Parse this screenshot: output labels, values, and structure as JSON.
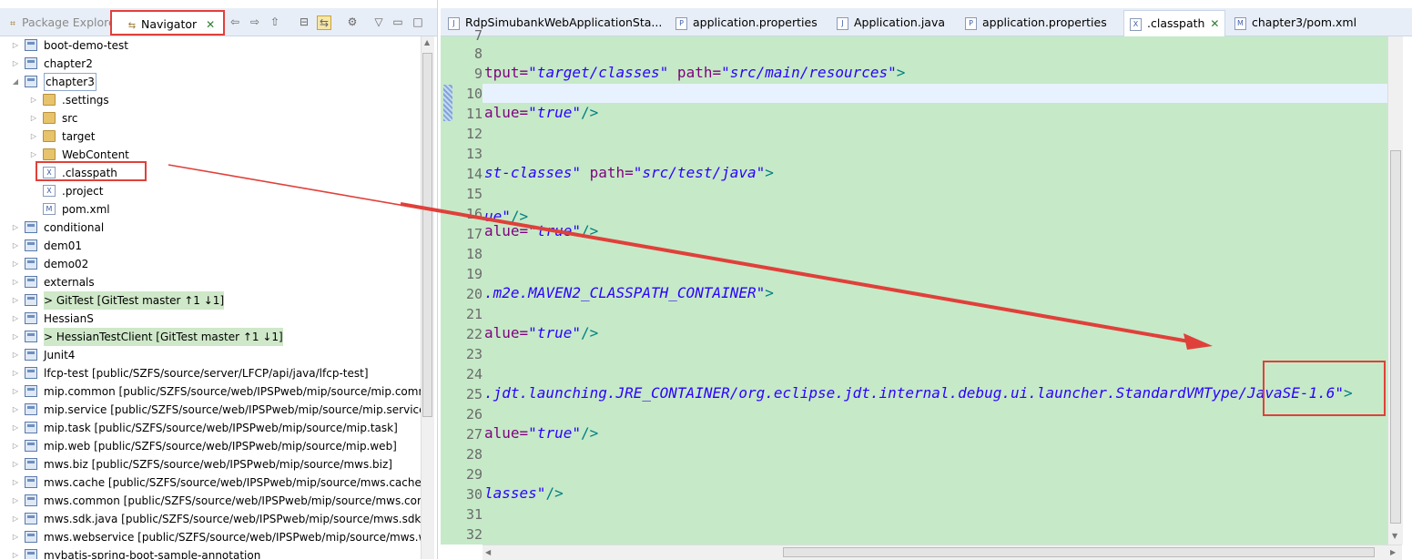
{
  "left_panel": {
    "tabs": [
      {
        "label": "Package Explorer",
        "active": false
      },
      {
        "label": "Navigator",
        "active": true
      }
    ],
    "toolbar_icons": [
      "back-icon",
      "forward-icon",
      "up-icon",
      "collapse-all-icon",
      "link-with-editor-icon",
      "filters-icon",
      "view-menu-icon",
      "minimize-icon",
      "maximize-icon"
    ],
    "tree": [
      {
        "label": "boot-demo-test",
        "level": 0,
        "icon": "project",
        "expanded": false
      },
      {
        "label": "chapter2",
        "level": 0,
        "icon": "project",
        "expanded": false
      },
      {
        "label": "chapter3",
        "level": 0,
        "icon": "project",
        "expanded": true,
        "selected": true
      },
      {
        "label": ".settings",
        "level": 1,
        "icon": "folder",
        "expanded": false
      },
      {
        "label": "src",
        "level": 1,
        "icon": "folder",
        "expanded": false
      },
      {
        "label": "target",
        "level": 1,
        "icon": "folder",
        "expanded": false
      },
      {
        "label": "WebContent",
        "level": 1,
        "icon": "folder",
        "expanded": false
      },
      {
        "label": ".classpath",
        "level": 1,
        "icon": "xml-file",
        "leaf": true,
        "highlighted": true
      },
      {
        "label": ".project",
        "level": 1,
        "icon": "xml-file",
        "leaf": true
      },
      {
        "label": "pom.xml",
        "level": 1,
        "icon": "maven-file",
        "leaf": true
      },
      {
        "label": "conditional",
        "level": 0,
        "icon": "project",
        "expanded": false
      },
      {
        "label": "dem01",
        "level": 0,
        "icon": "project",
        "expanded": false
      },
      {
        "label": "demo02",
        "level": 0,
        "icon": "project",
        "expanded": false
      },
      {
        "label": "externals",
        "level": 0,
        "icon": "project",
        "expanded": false
      },
      {
        "label": "> GitTest  [GitTest master ↑1 ↓1]",
        "level": 0,
        "icon": "project",
        "expanded": false,
        "git": true
      },
      {
        "label": "HessianS",
        "level": 0,
        "icon": "project",
        "expanded": false
      },
      {
        "label": "> HessianTestClient  [GitTest master ↑1 ↓1]",
        "level": 0,
        "icon": "project",
        "expanded": false,
        "git": true
      },
      {
        "label": "Junit4",
        "level": 0,
        "icon": "project",
        "expanded": false
      },
      {
        "label": "lfcp-test [public/SZFS/source/server/LFCP/api/java/lfcp-test]",
        "level": 0,
        "icon": "project",
        "expanded": false
      },
      {
        "label": "mip.common [public/SZFS/source/web/IPSPweb/mip/source/mip.common]",
        "level": 0,
        "icon": "project",
        "expanded": false
      },
      {
        "label": "mip.service [public/SZFS/source/web/IPSPweb/mip/source/mip.service]",
        "level": 0,
        "icon": "project",
        "expanded": false
      },
      {
        "label": "mip.task [public/SZFS/source/web/IPSPweb/mip/source/mip.task]",
        "level": 0,
        "icon": "project",
        "expanded": false
      },
      {
        "label": "mip.web [public/SZFS/source/web/IPSPweb/mip/source/mip.web]",
        "level": 0,
        "icon": "project",
        "expanded": false
      },
      {
        "label": "mws.biz [public/SZFS/source/web/IPSPweb/mip/source/mws.biz]",
        "level": 0,
        "icon": "project",
        "expanded": false
      },
      {
        "label": "mws.cache [public/SZFS/source/web/IPSPweb/mip/source/mws.cache]",
        "level": 0,
        "icon": "project",
        "expanded": false
      },
      {
        "label": "mws.common [public/SZFS/source/web/IPSPweb/mip/source/mws.common]",
        "level": 0,
        "icon": "project",
        "expanded": false
      },
      {
        "label": "mws.sdk.java [public/SZFS/source/web/IPSPweb/mip/source/mws.sdk.java]",
        "level": 0,
        "icon": "project",
        "expanded": false
      },
      {
        "label": "mws.webservice [public/SZFS/source/web/IPSPweb/mip/source/mws.webservice]",
        "level": 0,
        "icon": "project",
        "expanded": false
      },
      {
        "label": "mybatis-spring-boot-sample-annotation",
        "level": 0,
        "icon": "project",
        "expanded": false
      }
    ]
  },
  "editor": {
    "tabs": [
      {
        "label": "RdpSimubankWebApplicationSta...",
        "icon": "J",
        "active": false
      },
      {
        "label": "application.properties",
        "icon": "P",
        "active": false
      },
      {
        "label": "Application.java",
        "icon": "J",
        "active": false
      },
      {
        "label": "application.properties",
        "icon": "P",
        "active": false
      },
      {
        "label": ".classpath",
        "icon": "X",
        "active": true
      },
      {
        "label": "chapter3/pom.xml",
        "icon": "M",
        "active": false
      }
    ],
    "lines": [
      {
        "n": "7",
        "segments": []
      },
      {
        "n": "8",
        "segments": []
      },
      {
        "n": "9",
        "segments": [
          {
            "t": "tput=",
            "c": "a"
          },
          {
            "t": "\"target/classes\"",
            "c": "v"
          },
          {
            "t": " path=",
            "c": "a"
          },
          {
            "t": "\"src/main/resources\"",
            "c": "v"
          },
          {
            "t": ">",
            "c": "t"
          }
        ]
      },
      {
        "n": "10",
        "segments": []
      },
      {
        "n": "11",
        "segments": [
          {
            "t": "alue=",
            "c": "a"
          },
          {
            "t": "\"true\"",
            "c": "v"
          },
          {
            "t": "/>",
            "c": "t"
          }
        ]
      },
      {
        "n": "12",
        "segments": []
      },
      {
        "n": "13",
        "segments": []
      },
      {
        "n": "14",
        "segments": [
          {
            "t": "st-classes\"",
            "c": "v"
          },
          {
            "t": " path=",
            "c": "a"
          },
          {
            "t": "\"src/test/java\"",
            "c": "v"
          },
          {
            "t": ">",
            "c": "t"
          }
        ]
      },
      {
        "n": "15",
        "segments": []
      },
      {
        "n": "16",
        "segments": [
          {
            "t": "ue\"",
            "c": "v"
          },
          {
            "t": "/>",
            "c": "t"
          }
        ]
      },
      {
        "n": "17",
        "segments": [
          {
            "t": "alue=",
            "c": "a"
          },
          {
            "t": "\"true\"",
            "c": "v"
          },
          {
            "t": "/>",
            "c": "t"
          }
        ]
      },
      {
        "n": "18",
        "segments": []
      },
      {
        "n": "19",
        "segments": []
      },
      {
        "n": "20",
        "segments": [
          {
            "t": ".m2e.MAVEN2_CLASSPATH_CONTAINER\"",
            "c": "v"
          },
          {
            "t": ">",
            "c": "t"
          }
        ]
      },
      {
        "n": "21",
        "segments": []
      },
      {
        "n": "22",
        "segments": [
          {
            "t": "alue=",
            "c": "a"
          },
          {
            "t": "\"true\"",
            "c": "v"
          },
          {
            "t": "/>",
            "c": "t"
          }
        ]
      },
      {
        "n": "23",
        "segments": []
      },
      {
        "n": "24",
        "segments": []
      },
      {
        "n": "25",
        "segments": [
          {
            "t": ".jdt.launching.JRE_CONTAINER/org.eclipse.jdt.internal.debug.ui.launcher.StandardVMType/JavaSE-1.6\"",
            "c": "v"
          },
          {
            "t": ">",
            "c": "t"
          }
        ]
      },
      {
        "n": "26",
        "segments": []
      },
      {
        "n": "27",
        "segments": [
          {
            "t": "alue=",
            "c": "a"
          },
          {
            "t": "\"true\"",
            "c": "v"
          },
          {
            "t": "/>",
            "c": "t"
          }
        ]
      },
      {
        "n": "28",
        "segments": []
      },
      {
        "n": "29",
        "segments": []
      },
      {
        "n": "30",
        "segments": [
          {
            "t": "lasses\"",
            "c": "v"
          },
          {
            "t": "/>",
            "c": "t"
          }
        ]
      },
      {
        "n": "31",
        "segments": []
      },
      {
        "n": "32",
        "segments": []
      }
    ]
  },
  "annotation": {
    "highlight_color": "#e0403a",
    "arrow_from": ".classpath",
    "arrow_to": "JavaSE-1.6"
  },
  "colors": {
    "editor_bg": "#c6e9c8",
    "current_line": "#e8f2fe",
    "attr": "#7f007f",
    "value": "#2a00ff",
    "tag": "#008080",
    "git_decoration": "#cfe8c9"
  }
}
